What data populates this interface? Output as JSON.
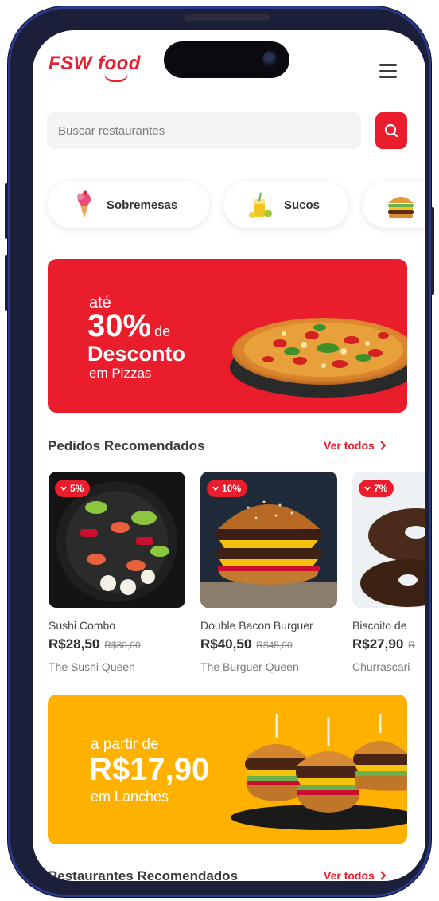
{
  "app": {
    "logo_text": "FSW food",
    "brand_color": "#ea1d2c",
    "menu_icon": "hamburger-menu-icon"
  },
  "search": {
    "placeholder": "Buscar restaurantes",
    "button_icon": "search-icon"
  },
  "categories": [
    {
      "label": "Sobremesas",
      "icon": "ice-cream-icon"
    },
    {
      "label": "Sucos",
      "icon": "juice-icon"
    },
    {
      "label": "",
      "icon": "burger-icon"
    }
  ],
  "promo_pizza": {
    "line1": "até",
    "percent": "30%",
    "de": "de",
    "line3": "Desconto",
    "line4": "em Pizzas",
    "bg_color": "#ea1d2c"
  },
  "recommended_orders": {
    "title": "Pedidos Recomendados",
    "see_all": "Ver todos",
    "products": [
      {
        "discount": "5%",
        "name": "Sushi Combo",
        "price": "R$28,50",
        "old_price": "R$30,00",
        "restaurant": "The Sushi Queen"
      },
      {
        "discount": "10%",
        "name": "Double Bacon Burguer",
        "price": "R$40,50",
        "old_price": "R$45,00",
        "restaurant": "The Burguer Queen"
      },
      {
        "discount": "7%",
        "name": "Biscoito de",
        "price": "R$27,90",
        "old_price": "R",
        "restaurant": "Churrascari"
      }
    ]
  },
  "promo_burger": {
    "line1": "a partir de",
    "price": "R$17,90",
    "line3": "em Lanches",
    "bg_color": "#ffb100"
  },
  "recommended_restaurants": {
    "title": "Restaurantes Recomendados",
    "see_all": "Ver todos"
  }
}
